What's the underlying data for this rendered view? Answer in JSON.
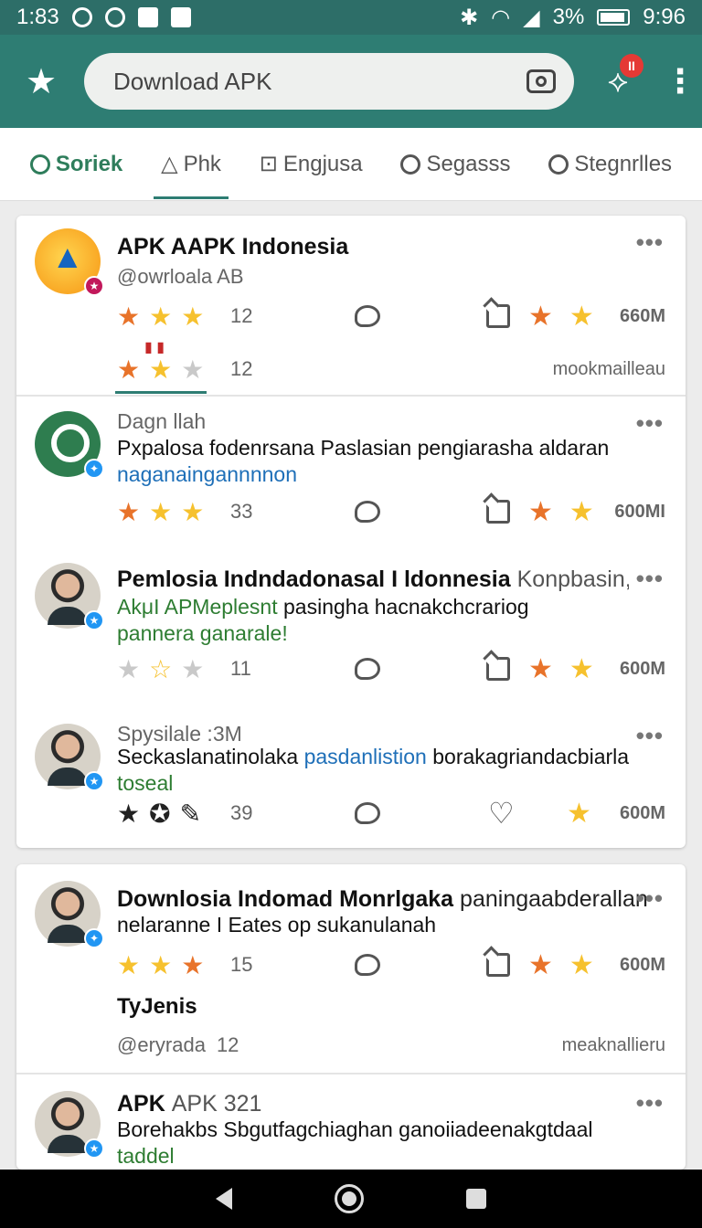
{
  "status_bar": {
    "time_left": "1:83",
    "battery": "3%",
    "time_right": "9:96"
  },
  "app_bar": {
    "search_placeholder": "Download APK",
    "notification_count": "II"
  },
  "tabs": [
    {
      "label": "Soriek"
    },
    {
      "label": "Phk"
    },
    {
      "label": "Engjusa"
    },
    {
      "label": "Segasss"
    },
    {
      "label": "Stegnrlles"
    }
  ],
  "posts": [
    {
      "title": "APK AAPK Indonesia",
      "handle": "@owrloala AB",
      "count": "12",
      "views": "660M",
      "second_count": "12",
      "footer_note": "mookmailleau"
    },
    {
      "header": "Dagn llah",
      "text": "Pxpalosa fodenrsana Paslasian pengiarasha aldaran",
      "text_highlight": "naganaingannnnon",
      "count": "33",
      "views": "600MI"
    },
    {
      "title": "Pemlosia Indndadonasal I ldonnesia",
      "title_suffix": "Konpbasin,",
      "green_text": "AkμI APMeplesnt",
      "text": "pasingha hacnakchcrariog",
      "green_text2": "pannera ganarale!",
      "count": "11",
      "views": "600M"
    },
    {
      "header": "Spysilale  :3M",
      "text": "Seckaslanatinolaka",
      "text_highlight": "pasdanlistion",
      "text_tail": "borakagriandacbiarla",
      "green_text": "toseal",
      "count": "39",
      "views": "600M"
    },
    {
      "title": "Downlosia Indomad Monrlgaka",
      "title_suffix": "paningaabderallan",
      "text": "nelaranne I Eates op sukanulanah",
      "count": "15",
      "views": "600M",
      "subheading": "TyJenis",
      "handle": "@eryrada",
      "second_count": "12",
      "footer_note": "meaknallieru"
    },
    {
      "title": "APK",
      "title_suffix": "APK 321",
      "text": "Borehakbs Sbgutfagchiaghan ganoiiadeenakgtdaal",
      "green_text": "taddel"
    }
  ],
  "icons": {
    "star": "star-icon",
    "comment": "comment-icon",
    "share": "share-icon",
    "heart": "heart-icon"
  },
  "colors": {
    "accent": "#2e7d73",
    "star_orange": "#e8732a",
    "star_yellow": "#f6c12e",
    "link_blue": "#1e6fb8",
    "green_text": "#2e7d32"
  }
}
